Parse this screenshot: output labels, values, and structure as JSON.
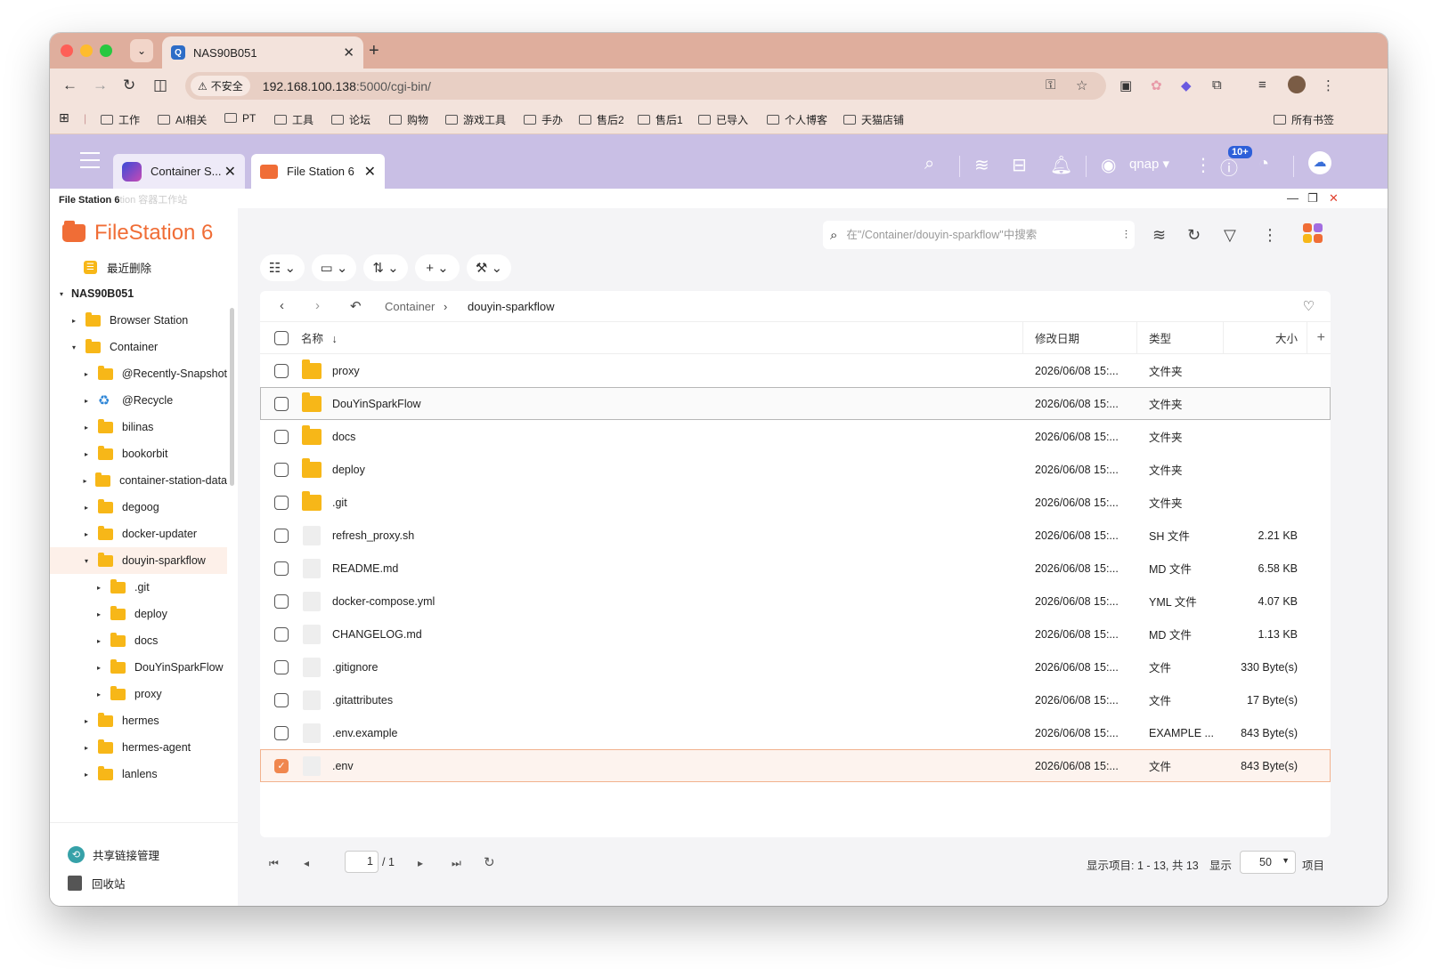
{
  "browser": {
    "tab_title": "NAS90B051",
    "tab_favicon": "Q",
    "insecure_label": "不安全",
    "url_host": "192.168.100.138",
    "url_rest": ":5000/cgi-bin/",
    "bookmarks": [
      "工作",
      "AI相关",
      "PT",
      "工具",
      "论坛",
      "购物",
      "游戏工具",
      "手办",
      "售后2",
      "售后1",
      "已导入",
      "个人博客",
      "天猫店铺"
    ],
    "all_bookmarks": "所有书签"
  },
  "qts": {
    "tabs": [
      {
        "label": "Container S..."
      },
      {
        "label": "File Station 6"
      }
    ],
    "user": "qnap",
    "badge": "10+",
    "window_title": "File Station 6",
    "window_ghost": "tion 容器工作站"
  },
  "sidebar": {
    "logo": "FileStation 6",
    "recent_delete": "最近删除",
    "tree": [
      {
        "label": "NAS90B051",
        "level": 0,
        "arrow": "▾",
        "type": "root"
      },
      {
        "label": "Browser Station",
        "level": 1,
        "arrow": "▸",
        "type": "folder"
      },
      {
        "label": "Container",
        "level": 1,
        "arrow": "▾",
        "type": "folder"
      },
      {
        "label": "@Recently-Snapshot",
        "level": 2,
        "arrow": "▸",
        "type": "folder"
      },
      {
        "label": "@Recycle",
        "level": 2,
        "arrow": "▸",
        "type": "recycle"
      },
      {
        "label": "bilinas",
        "level": 2,
        "arrow": "▸",
        "type": "folder"
      },
      {
        "label": "bookorbit",
        "level": 2,
        "arrow": "▸",
        "type": "folder"
      },
      {
        "label": "container-station-data",
        "level": 2,
        "arrow": "▸",
        "type": "folder"
      },
      {
        "label": "degoog",
        "level": 2,
        "arrow": "▸",
        "type": "folder"
      },
      {
        "label": "docker-updater",
        "level": 2,
        "arrow": "▸",
        "type": "folder"
      },
      {
        "label": "douyin-sparkflow",
        "level": 2,
        "arrow": "▾",
        "type": "folder",
        "selected": true
      },
      {
        "label": ".git",
        "level": 3,
        "arrow": "▸",
        "type": "folder"
      },
      {
        "label": "deploy",
        "level": 3,
        "arrow": "▸",
        "type": "folder"
      },
      {
        "label": "docs",
        "level": 3,
        "arrow": "▸",
        "type": "folder"
      },
      {
        "label": "DouYinSparkFlow",
        "level": 3,
        "arrow": "▸",
        "type": "folder"
      },
      {
        "label": "proxy",
        "level": 3,
        "arrow": "▸",
        "type": "folder"
      },
      {
        "label": "hermes",
        "level": 2,
        "arrow": "▸",
        "type": "folder"
      },
      {
        "label": "hermes-agent",
        "level": 2,
        "arrow": "▸",
        "type": "folder"
      },
      {
        "label": "lanlens",
        "level": 2,
        "arrow": "▸",
        "type": "folder"
      }
    ],
    "share_links": "共享链接管理",
    "recycle_bin": "回收站"
  },
  "main": {
    "search_placeholder": "在\"/Container/douyin-sparkflow\"中搜索",
    "breadcrumb": [
      "Container",
      "douyin-sparkflow"
    ],
    "columns": {
      "name": "名称",
      "date": "修改日期",
      "type": "类型",
      "size": "大小"
    },
    "files": [
      {
        "name": "proxy",
        "date": "2026/06/08 15:...",
        "type": "文件夹",
        "size": "",
        "kind": "folder"
      },
      {
        "name": "DouYinSparkFlow",
        "date": "2026/06/08 15:...",
        "type": "文件夹",
        "size": "",
        "kind": "folder",
        "state": "hover"
      },
      {
        "name": "docs",
        "date": "2026/06/08 15:...",
        "type": "文件夹",
        "size": "",
        "kind": "folder"
      },
      {
        "name": "deploy",
        "date": "2026/06/08 15:...",
        "type": "文件夹",
        "size": "",
        "kind": "folder"
      },
      {
        "name": ".git",
        "date": "2026/06/08 15:...",
        "type": "文件夹",
        "size": "",
        "kind": "folder"
      },
      {
        "name": "refresh_proxy.sh",
        "date": "2026/06/08 15:...",
        "type": "SH 文件",
        "size": "2.21 KB",
        "kind": "file"
      },
      {
        "name": "README.md",
        "date": "2026/06/08 15:...",
        "type": "MD 文件",
        "size": "6.58 KB",
        "kind": "file"
      },
      {
        "name": "docker-compose.yml",
        "date": "2026/06/08 15:...",
        "type": "YML 文件",
        "size": "4.07 KB",
        "kind": "file"
      },
      {
        "name": "CHANGELOG.md",
        "date": "2026/06/08 15:...",
        "type": "MD 文件",
        "size": "1.13 KB",
        "kind": "file"
      },
      {
        "name": ".gitignore",
        "date": "2026/06/08 15:...",
        "type": "文件",
        "size": "330 Byte(s)",
        "kind": "file"
      },
      {
        "name": ".gitattributes",
        "date": "2026/06/08 15:...",
        "type": "文件",
        "size": "17 Byte(s)",
        "kind": "file"
      },
      {
        "name": ".env.example",
        "date": "2026/06/08 15:...",
        "type": "EXAMPLE ...",
        "size": "843 Byte(s)",
        "kind": "file"
      },
      {
        "name": ".env",
        "date": "2026/06/08 15:...",
        "type": "文件",
        "size": "843 Byte(s)",
        "kind": "file",
        "state": "checked"
      }
    ],
    "pager": {
      "page": "1",
      "total_pages": "/ 1",
      "summary": "显示项目: 1 - 13, 共 13",
      "show_label": "显示",
      "per_page": "50",
      "items_label": "项目"
    }
  },
  "colors": {
    "accent": "#f06d36",
    "qts_bar": "#c9bfe5",
    "browser_frame": "#dfae9d"
  }
}
